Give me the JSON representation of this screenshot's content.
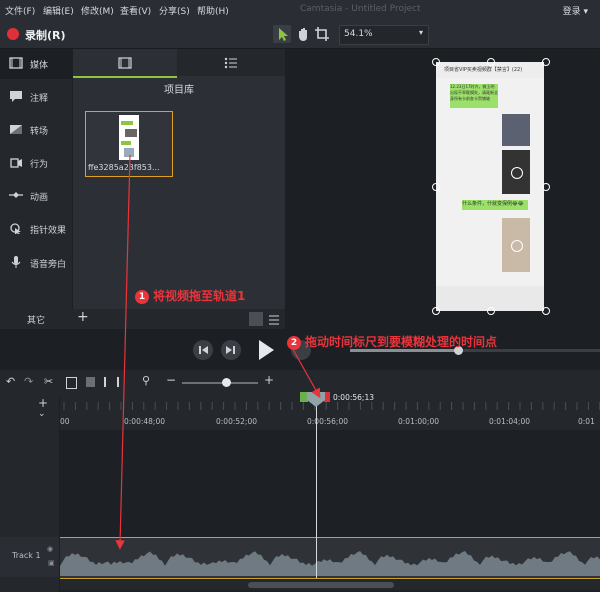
{
  "menu": {
    "items": [
      "文件(F)",
      "编辑(E)",
      "修改(M)",
      "查看(V)",
      "分享(S)",
      "帮助(H)"
    ],
    "window_title": "Camtasia - Untitled Project",
    "login": "登录 ▾"
  },
  "toolbar": {
    "record_label": "录制(R)",
    "zoom_value": "54.1%",
    "icons": [
      "pointer-icon",
      "hand-icon",
      "crop-icon"
    ]
  },
  "tools": {
    "items": [
      {
        "label": "媒体",
        "icon": "media-icon"
      },
      {
        "label": "注释",
        "icon": "annotation-icon"
      },
      {
        "label": "转场",
        "icon": "transition-icon"
      },
      {
        "label": "行为",
        "icon": "behavior-icon"
      },
      {
        "label": "动画",
        "icon": "animation-icon"
      },
      {
        "label": "指针效果",
        "icon": "cursor-effect-icon"
      },
      {
        "label": "语音旁白",
        "icon": "mic-icon"
      }
    ],
    "more_label": "其它",
    "add_label": "+"
  },
  "bin": {
    "title": "项目库",
    "clip_name": "ffe3285a23f853..."
  },
  "preview": {
    "chat_header": "项目省VIP买卖视频群【禁言】(22)",
    "msg1": "12.23日17时许，微玉明出现不乖耽搁失，请尾新全身所有卡前各卡贺铺轴",
    "msg2": "什么条件，什就变保例😂😂"
  },
  "timeline": {
    "playhead_time": "0:00:56;13",
    "ticks": [
      "00",
      "0:00:48;00",
      "0:00:52;00",
      "0:00:56;00",
      "0:01:00;00",
      "0:01:04;00",
      "0:01"
    ],
    "track_label": "Track 1"
  },
  "annotations": {
    "note1": "将视频拖至轨道1",
    "note1_num": "1",
    "note2": "拖动时间标尺到要模糊处理的时间点",
    "note2_num": "2"
  },
  "colors": {
    "accent": "#8cc63f",
    "record": "#e0303a",
    "note": "#e8343a",
    "track_border": "#c9a227"
  }
}
